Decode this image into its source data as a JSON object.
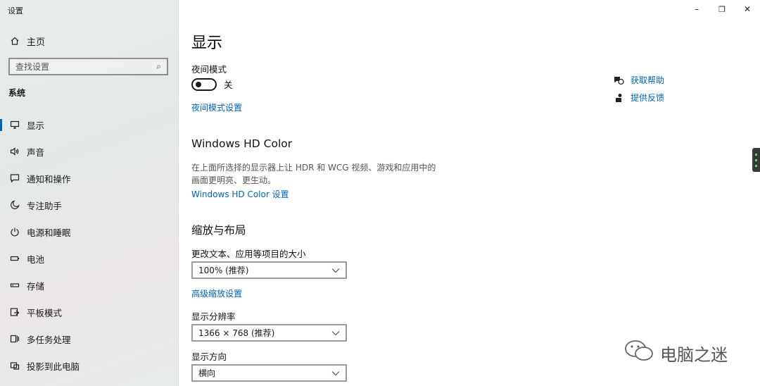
{
  "window": {
    "title": "设置",
    "minimize": "–",
    "restore": "❐",
    "close": "✕"
  },
  "sidebar": {
    "home_label": "主页",
    "search_placeholder": "查找设置",
    "section": "系统",
    "items": [
      {
        "label": "显示",
        "icon": "monitor-icon",
        "active": true
      },
      {
        "label": "声音",
        "icon": "speaker-icon"
      },
      {
        "label": "通知和操作",
        "icon": "notification-icon"
      },
      {
        "label": "专注助手",
        "icon": "moon-icon"
      },
      {
        "label": "电源和睡眠",
        "icon": "power-icon"
      },
      {
        "label": "电池",
        "icon": "battery-icon"
      },
      {
        "label": "存储",
        "icon": "storage-icon"
      },
      {
        "label": "平板模式",
        "icon": "tablet-icon"
      },
      {
        "label": "多任务处理",
        "icon": "multitask-icon"
      },
      {
        "label": "投影到此电脑",
        "icon": "project-icon"
      }
    ]
  },
  "main": {
    "title": "显示",
    "night_light": {
      "label": "夜间模式",
      "toggle_state": "关",
      "settings_link": "夜间模式设置"
    },
    "hd_color": {
      "heading": "Windows HD Color",
      "description": "在上面所选择的显示器上让 HDR 和 WCG 视频、游戏和应用中的画面更明亮、更生动。",
      "link": "Windows HD Color 设置"
    },
    "scale_layout": {
      "heading": "缩放与布局",
      "scale_label": "更改文本、应用等项目的大小",
      "scale_value": "100% (推荐)",
      "advanced_link": "高级缩放设置",
      "resolution_label": "显示分辨率",
      "resolution_value": "1366 × 768 (推荐)",
      "orientation_label": "显示方向",
      "orientation_value": "横向"
    }
  },
  "help": {
    "get_help": "获取帮助",
    "feedback": "提供反馈"
  },
  "watermark": "电脑之迷",
  "colors": {
    "accent": "#0063b1"
  }
}
